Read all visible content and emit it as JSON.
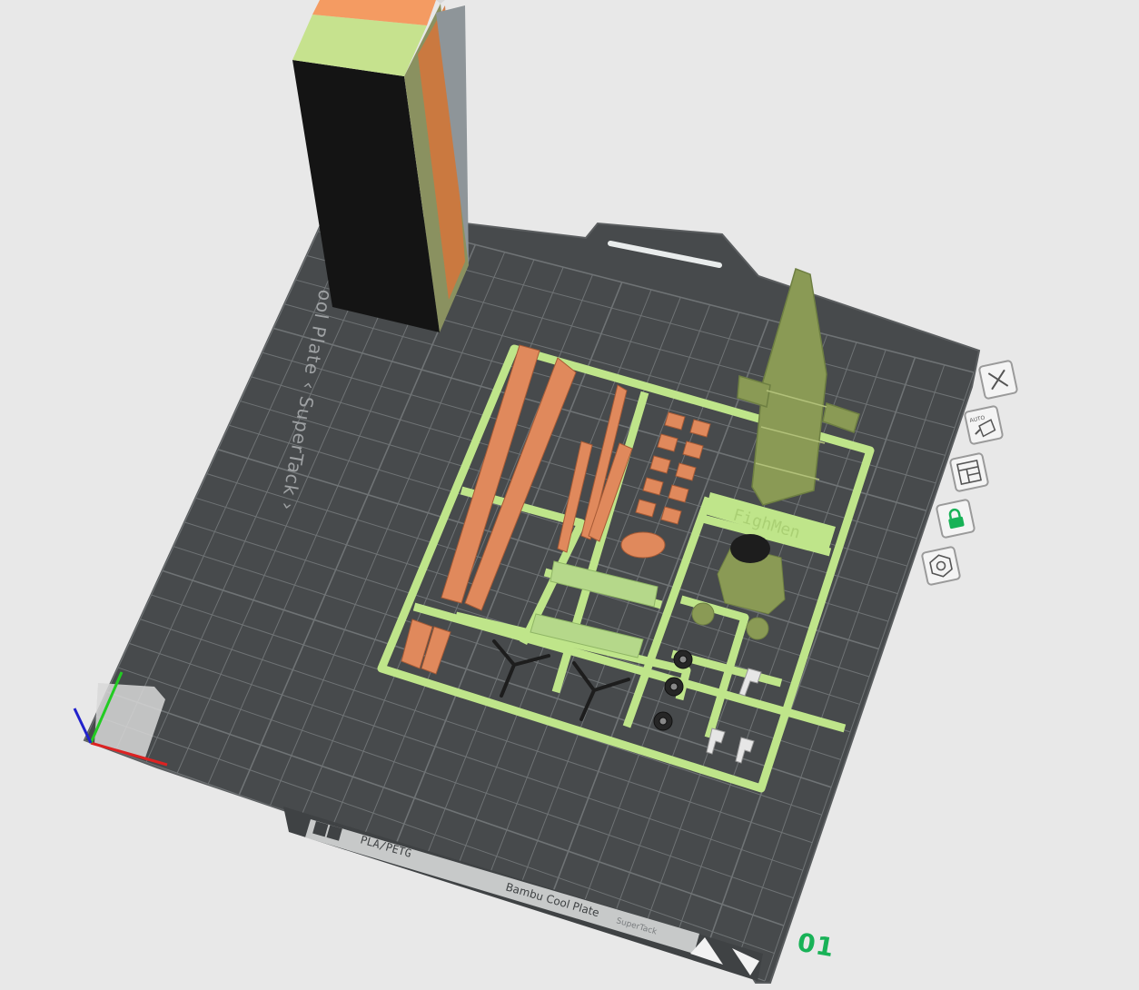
{
  "plate": {
    "side_label": "ool Plate ‹ SuperTack ›",
    "brand_tag": "PLA/PETG",
    "name_label": "Bambu Cool Plate",
    "name_sub": "SuperTack",
    "number": "01",
    "sprue_emboss": "FighMen"
  },
  "toolbar": {
    "close_icon": "close-x-icon",
    "arrange_icon": "auto-arrange-icon",
    "arrange_label": "AUTO",
    "layout_icon": "plate-layout-icon",
    "lock_icon": "lock-icon",
    "settings_icon": "hex-nut-settings-icon"
  },
  "colors": {
    "background": "#e8e8e8",
    "bed": "#474a4c",
    "grid": "#6f7375",
    "sprue": "#bfe58a",
    "orange_parts": "#e0895c",
    "olive_parts": "#8a9a55",
    "wipe_tower_black": "#141414",
    "accent_green": "#18b257",
    "lock_green": "#18b257"
  }
}
